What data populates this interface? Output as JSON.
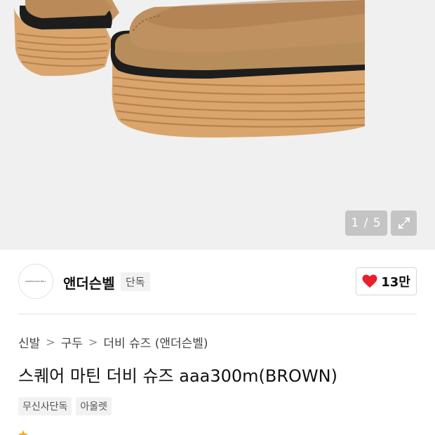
{
  "gallery": {
    "counter": "1 / 5",
    "expand_icon": "expand-arrows-icon"
  },
  "brand": {
    "name": "앤더슨벨",
    "logo_text": "ANDERSSON BELL",
    "exclusive_tag": "단독"
  },
  "like": {
    "icon": "heart-icon",
    "color": "#e8202a",
    "count": "13만"
  },
  "breadcrumb": {
    "items": [
      "신발",
      "구두",
      "더비 슈즈 (앤더슨벨)"
    ],
    "separator": ">"
  },
  "product": {
    "title": "스퀘어 마틴 더비 슈즈 aaa300m(BROWN)",
    "tags": [
      "무신사단독",
      "아울렛"
    ]
  },
  "colors": {
    "suede": "#b88d5c",
    "sole": "#d9a56c",
    "welt": "#222222"
  }
}
